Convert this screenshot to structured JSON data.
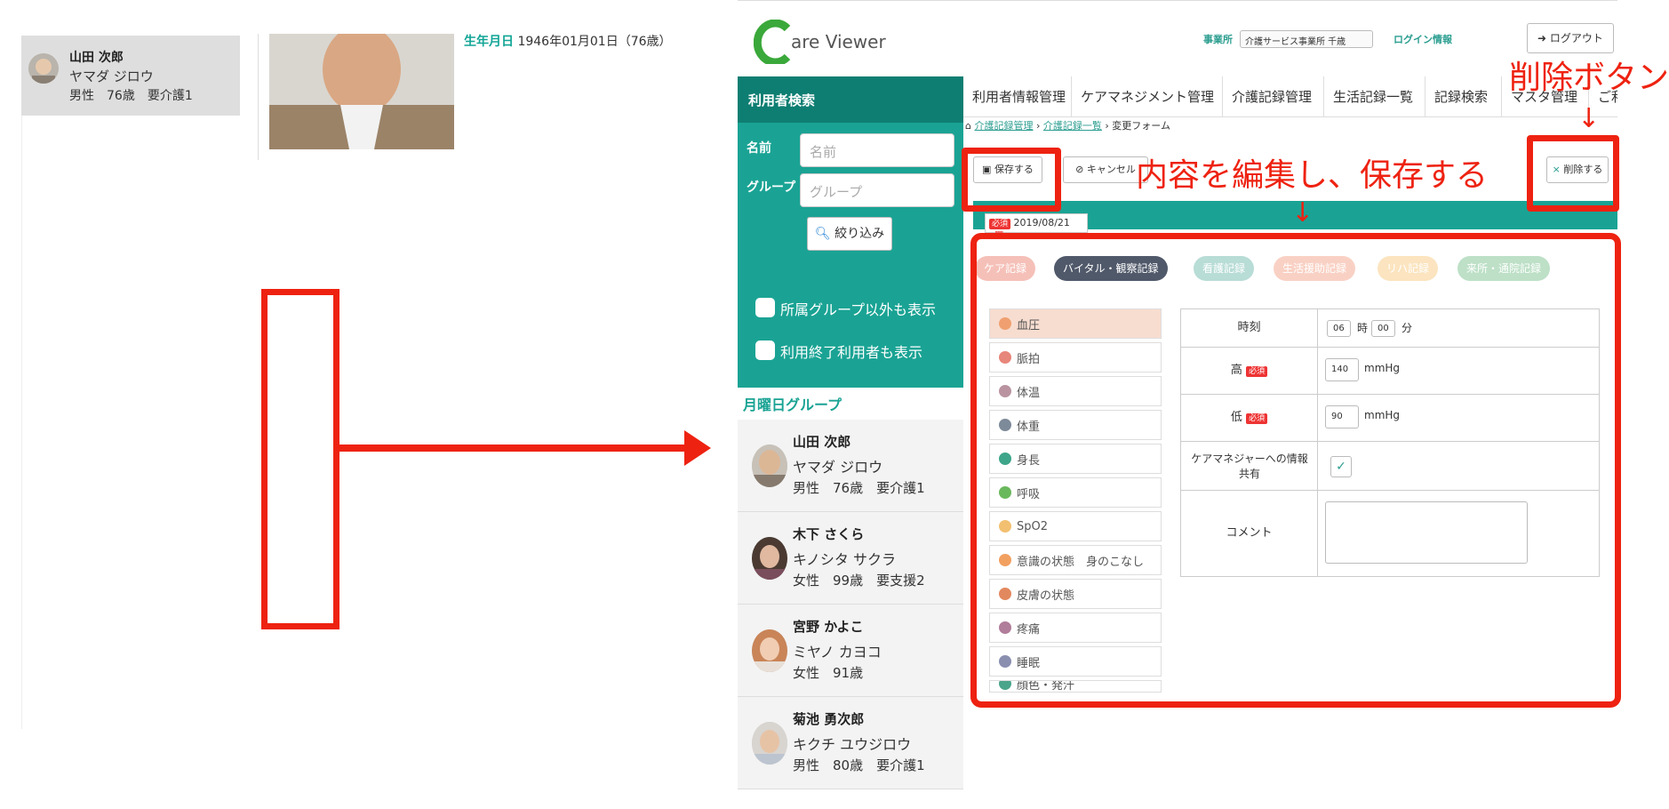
{
  "left": {
    "user": {
      "name": "山田 次郎",
      "kana": "ヤマダ ジロウ",
      "info": "男性　76歳　要介護1"
    },
    "birth_label": "生年月日",
    "birth_value": "1946年01月01日（76歳）"
  },
  "header": {
    "logo_c": "C",
    "logo_text": "are Viewer",
    "office_label": "事業所",
    "office_value": "介護サービス事業所 千歳",
    "login_info": "ログイン情報",
    "logout": "ログアウト"
  },
  "sidebar": {
    "title": "利用者検索",
    "name_label": "名前",
    "name_placeholder": "名前",
    "group_label": "グループ",
    "group_placeholder": "グループ",
    "filter_button": "絞り込み",
    "check1": "所属グループ以外も表示",
    "check2": "利用終了利用者も表示",
    "group_title": "月曜日グループ",
    "users": [
      {
        "name": "山田 次郎",
        "kana": "ヤマダ ジロウ",
        "info": "男性　76歳　要介護1"
      },
      {
        "name": "木下 さくら",
        "kana": "キノシタ サクラ",
        "info": "女性　99歳　要支援2"
      },
      {
        "name": "宮野 かよこ",
        "kana": "ミヤノ カヨコ",
        "info": "女性　91歳"
      },
      {
        "name": "菊池 勇次郎",
        "kana": "キクチ ユウジロウ",
        "info": "男性　80歳　要介護1"
      }
    ]
  },
  "nav": {
    "tabs": [
      "利用者情報管理",
      "ケアマネジメント管理",
      "介護記録管理",
      "生活記録一覧",
      "記録検索",
      "マスタ管理",
      "ご利"
    ]
  },
  "breadcrumb": {
    "a": "介護記録管理",
    "b": "介護記録一覧",
    "current": "変更フォーム",
    "sep": "›"
  },
  "form": {
    "save": "保存する",
    "cancel": "キャンセル",
    "delete": "削除する",
    "required": "必須",
    "date": "2019/08/21",
    "record_tabs": [
      "ケア記録",
      "バイタル・観察記録",
      "看護記録",
      "生活援助記録",
      "リハ記録",
      "来所・通院記録"
    ],
    "categories": [
      "血圧",
      "脈拍",
      "体温",
      "体重",
      "身長",
      "呼吸",
      "SpO2",
      "意識の状態　身のこなし",
      "皮膚の状態",
      "疼痛",
      "睡眠",
      "顔色・発汗"
    ],
    "time_label": "時刻",
    "hour": "06",
    "hour_unit": "時",
    "minute": "00",
    "minute_unit": "分",
    "high_label": "高",
    "high_value": "140",
    "low_label": "低",
    "low_value": "90",
    "unit": "mmHg",
    "share_label": "ケアマネジャーへの情報共有",
    "comment_label": "コメント"
  },
  "annotations": {
    "edit_save": "内容を編集し、保存する",
    "delete_button": "削除ボタン",
    "arrow": "↓"
  },
  "colors": {
    "teal": "#1aa394",
    "red": "#e21"
  }
}
